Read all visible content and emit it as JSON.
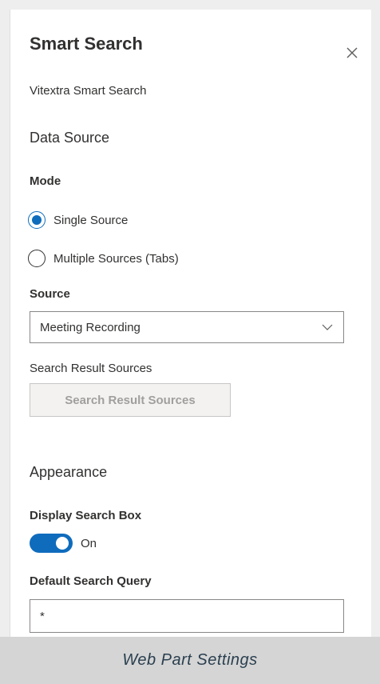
{
  "panel": {
    "title": "Smart Search",
    "subtitle": "Vitextra Smart Search",
    "close_icon": "close-icon"
  },
  "data_source": {
    "heading": "Data Source",
    "mode_label": "Mode",
    "mode_options": [
      {
        "label": "Single Source",
        "checked": true
      },
      {
        "label": "Multiple Sources (Tabs)",
        "checked": false
      }
    ],
    "source_label": "Source",
    "source_value": "Meeting Recording",
    "search_result_sources_label": "Search Result Sources",
    "search_result_sources_button": "Search Result Sources"
  },
  "appearance": {
    "heading": "Appearance",
    "display_search_box_label": "Display Search Box",
    "display_search_box_state": "On",
    "default_query_label": "Default Search Query",
    "default_query_value": "*"
  },
  "caption": "Web Part Settings",
  "colors": {
    "accent": "#0f6cbd",
    "disabled_text": "#a19f9d",
    "caption_bg": "#d5d5d5"
  }
}
